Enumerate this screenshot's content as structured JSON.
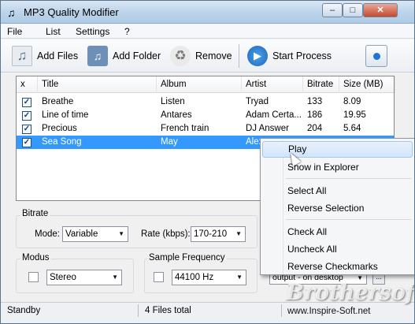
{
  "window": {
    "title": "MP3 Quality Modifier"
  },
  "menu": [
    "File",
    "List",
    "Settings",
    "?"
  ],
  "toolbar": {
    "add_files": "Add Files",
    "add_folder": "Add Folder",
    "remove": "Remove",
    "start_process": "Start Process"
  },
  "list": {
    "columns": [
      "x",
      "Title",
      "Album",
      "Artist",
      "Bitrate",
      "Size (MB)"
    ],
    "rows": [
      {
        "checked": true,
        "title": "Breathe",
        "album": "Listen",
        "artist": "Tryad",
        "bitrate": "133",
        "size": "8.09"
      },
      {
        "checked": true,
        "title": "Line of time",
        "album": "Antares",
        "artist": "Adam Certa...",
        "bitrate": "186",
        "size": "19.95"
      },
      {
        "checked": true,
        "title": "Precious",
        "album": "French train",
        "artist": "DJ Answer",
        "bitrate": "204",
        "size": "5.64"
      },
      {
        "checked": true,
        "title": "Sea Song",
        "album": "May",
        "artist": "Alex",
        "bitrate": "",
        "size": "",
        "selected": true
      }
    ]
  },
  "bitrate": {
    "group_label": "Bitrate",
    "mode_label": "Mode:",
    "mode_value": "Variable",
    "rate_label": "Rate (kbps):",
    "rate_value": "170-210"
  },
  "modus": {
    "group_label": "Modus",
    "value": "Stereo"
  },
  "sample_frequency": {
    "group_label": "Sample Frequency",
    "value": "44100 Hz"
  },
  "output": {
    "value": "output - on desktop"
  },
  "status": {
    "left": "Standby",
    "center": "4 Files total",
    "right": "www.Inspire-Soft.net"
  },
  "context_menu": {
    "items": [
      "Play",
      "Show in Explorer",
      "Select All",
      "Reverse Selection",
      "Check All",
      "Uncheck All",
      "Reverse Checkmarks"
    ]
  },
  "watermark": "Brothersoft",
  "colors": {
    "selection": "#3399ff",
    "titlebar": "#bcd3ea",
    "start_icon": "#1f66b8"
  }
}
